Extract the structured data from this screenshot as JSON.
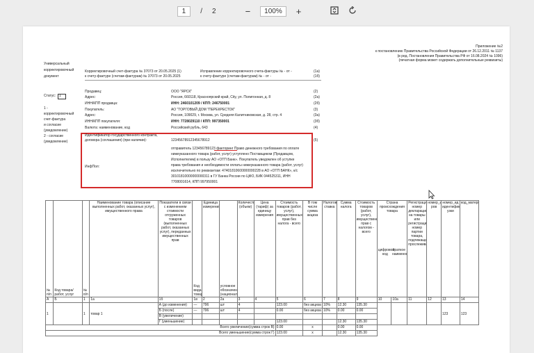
{
  "toolbar": {
    "current_page": "1",
    "separator": "/",
    "total_pages": "2",
    "zoom_out": "−",
    "zoom": "100%",
    "zoom_in": "+"
  },
  "appendix": [
    "Приложение №2",
    "к постановлению Правительства Российской Федерации от 26.12.2011 № 1137",
    "(в ред. Постановления Правительства РФ от 16.08.2024 № 1096)",
    "(печатная форма может содержать дополнительные реквизиты)"
  ],
  "left": {
    "doctype_lines": [
      "Универсальный",
      "корректировочный",
      "документ"
    ],
    "status_label": "Статус:",
    "status_value": "1",
    "status_desc_lines": [
      "1 -",
      "корректировочный",
      "счет-фактура",
      "и согласие",
      "(уведомление)",
      "2 - согласие",
      "(уведомление)"
    ]
  },
  "header": {
    "line1": "Корректировочный счет-фактура № 37073 от 20.05.2025 (1)",
    "line2": "к счету-фактуре (счетам-фактурам) № 37073 от 20.05.2025",
    "mid1": "Исправление корректировочного счета-фактуры № - от -",
    "mid2": "к счету-фактуре (счетам-фактурам) № - от -",
    "code1": "(1а)",
    "code2": "(1б)"
  },
  "fields": [
    {
      "label": "Продавец:",
      "value": "ООО \"ЯРСК\"",
      "code": "(2)"
    },
    {
      "label": "Адрес:",
      "value": "Россия, 660118, Красноярский край, City, ул. Полигонная, д. 8",
      "code": "(2а)"
    },
    {
      "label": "ИНН/КПП продавца:",
      "value": "ИНН: 2460101209 / КПП: 246750001",
      "code": "(2б)"
    },
    {
      "label": "Покупатель:",
      "value": "АО \"ТОРГОВЫЙ ДОМ \"ПЕРЕКРЕСТОК\"",
      "code": "(3)"
    },
    {
      "label": "Адрес:",
      "value": "Россия, 109029, г. Москва, ул. Средняя Калитниковская, д. 28, стр. 4",
      "code": "(3а)"
    },
    {
      "label": "ИНН/КПП покупателя:",
      "value": "ИНН: 7728029110 / КПП: 997350001",
      "code": "(3б)"
    },
    {
      "label": "Валюта: наименование, код",
      "value": "Российский рубль, 643",
      "code": "(4)"
    }
  ],
  "contract": {
    "label1": "Идентификатор государственного контракта,",
    "label2": "договора (соглашения) (при наличии):",
    "value": "12345678912345678912",
    "code": "(5)"
  },
  "infpol": {
    "label": "ИнфПол:",
    "lines": [
      "отправитель 123456789123 факторинг Право денежного требования по оплате",
      "нижеуказанного товара (работ, услуг) уступлено Поставщиком (Продавцом,",
      "Исполнителем) в пользу АО «ОТП Банк». Покупатель уведомлен об уступке",
      "права требования и необходимости оплаты нижеуказанного товара (работ, услуг)",
      "исключительно по реквизитам: 47401810600000000228 в АО «ОТП БАНК», к/с",
      "30101810000000000311 в ГУ Банка России по ЦФО, БИК 044525311, ИНН",
      "7708001614, КПП 997950001"
    ]
  },
  "table": {
    "headers": [
      "№ п/п",
      "Код товара/ работ, услуг",
      "№ п/п",
      "Наименование товара (описание выполненных работ, оказанных услуг), имущественного права",
      "Показатели в связи с изменением стоимости отгруженных товаров (выполненных работ, оказанных услуг), переданных имущественных прав",
      "Код вида товара",
      "Единица измерения",
      "условное обозначение (национальное)",
      "Количество (объем)",
      "Цена (тариф) за единицу измерения",
      "Стоимость товаров (работ, услуг), имущественных прав без налога - всего",
      "В том числе сумма акциза",
      "Налоговая ставка",
      "Сумма налога",
      "Стоимость товаров (работ, услуг), имущественных прав с налогом - всего",
      "Страна происхождения товара",
      "цифровой код",
      "краткое наименование",
      "Регистрационный номер декларации на товары или регистрационный номер партии товара, подлежащего прослеживаемости",
      "номер_ид ров",
      "номер_ид идентифик_об_отгр узки",
      "код_материала"
    ],
    "num_row": [
      "А",
      "Б",
      "1",
      "1а",
      "1б",
      "1в",
      "2",
      "2а",
      "3",
      "4",
      "5",
      "6",
      "7",
      "8",
      "9",
      "10",
      "10а",
      "11",
      "12",
      "13",
      "14"
    ],
    "row_num": "1",
    "row_pos": "1",
    "row_name": "товар 1",
    "row_code": "123",
    "row_mat": "123",
    "sub_rows": [
      {
        "label": "А (до изменения)",
        "kind": "—",
        "unit": "796",
        "unit_name": "шт",
        "qty": "4",
        "price": "",
        "cost": "123.00",
        "excise": "без акциза",
        "rate": "10%",
        "tax": "12.30",
        "total": "135.30"
      },
      {
        "label": "Б (после)",
        "kind": "—",
        "unit": "796",
        "unit_name": "шт",
        "qty": "4",
        "price": "",
        "cost": "0.00",
        "excise": "без акциза",
        "rate": "10%",
        "tax": "0.00",
        "total": "0.00"
      },
      {
        "label": "В (увеличение)",
        "kind": "",
        "unit": "",
        "unit_name": "",
        "qty": "",
        "price": "",
        "cost": "",
        "excise": "",
        "rate": "",
        "tax": "",
        "total": ""
      },
      {
        "label": "Г (уменьшение)",
        "kind": "",
        "unit": "",
        "unit_name": "",
        "qty": "",
        "price": "",
        "cost": "123.00",
        "excise": "",
        "rate": "",
        "tax": "12.30",
        "total": "135.30"
      }
    ],
    "total_increase": {
      "label": "Всего увеличение(сумма строк В)",
      "cost": "0.00",
      "excise": "х",
      "tax": "0.00",
      "total": "0.00"
    },
    "total_decrease": {
      "label": "Всего уменьшение(сумма строк Г)",
      "cost": "123.00",
      "excise": "х",
      "tax": "12.30",
      "total": "135.30"
    }
  }
}
